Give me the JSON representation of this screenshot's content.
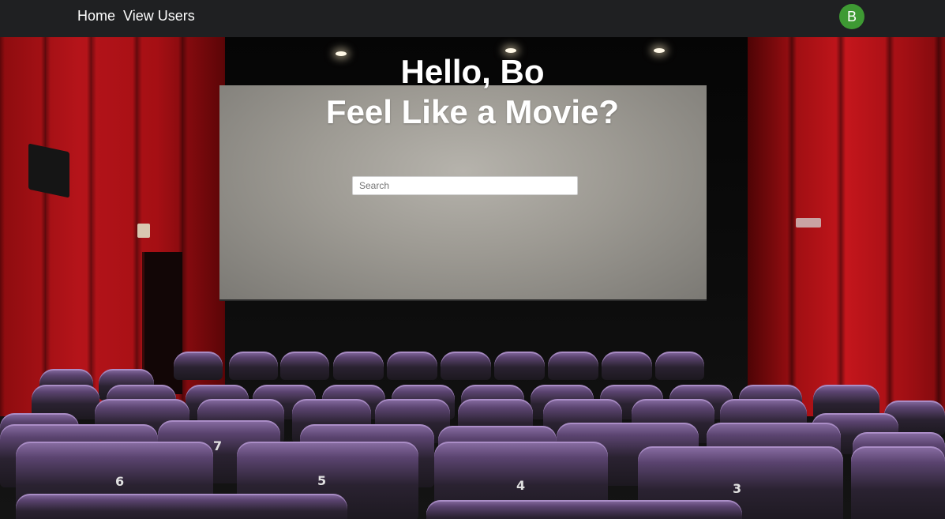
{
  "nav": {
    "links": [
      {
        "label": "Home"
      },
      {
        "label": "View Users"
      }
    ],
    "avatar_initial": "B",
    "avatar_color": "#3e9a33",
    "background_color": "#1f2022"
  },
  "hero": {
    "greeting": "Hello, Bo",
    "tagline": "Feel Like a Movie?"
  },
  "search": {
    "placeholder": "Search",
    "value": ""
  },
  "background": {
    "description_icon": "cinema-theater-image",
    "seat_numbers": [
      "7",
      "6",
      "5",
      "4",
      "3"
    ]
  }
}
